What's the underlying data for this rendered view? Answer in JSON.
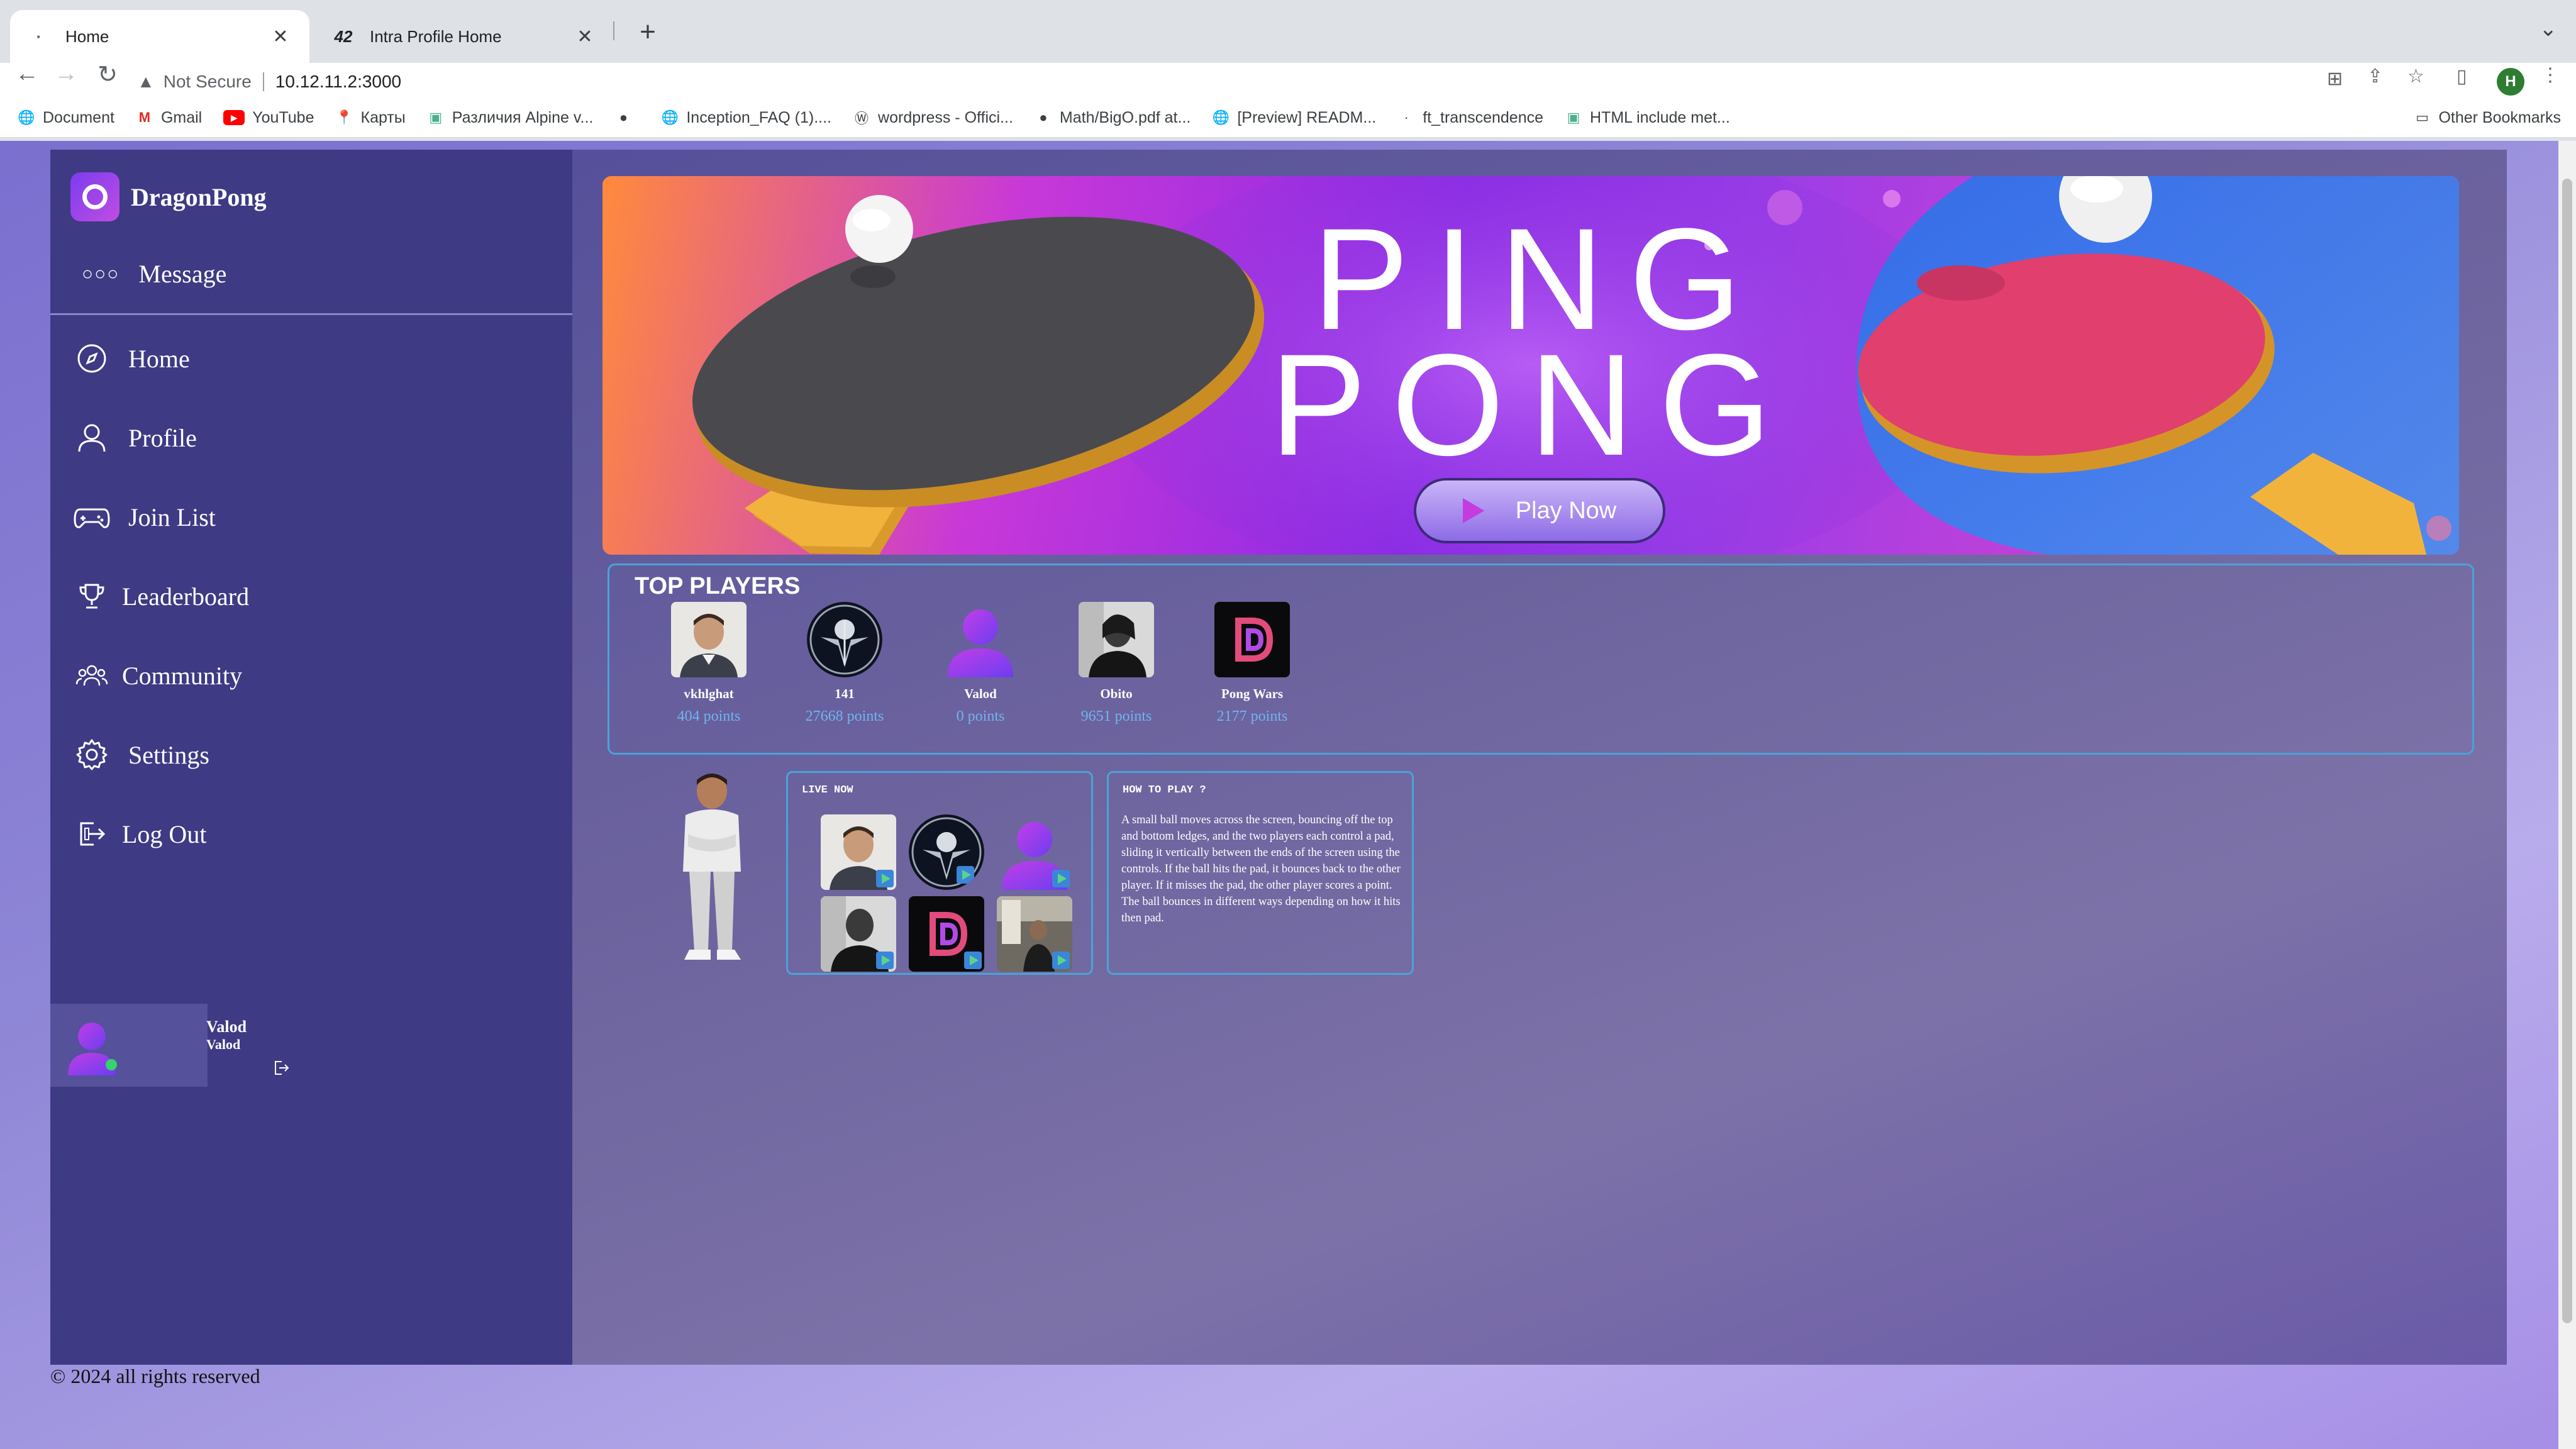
{
  "browser": {
    "tabs": [
      {
        "title": "Home",
        "favicon": "dot-icon"
      },
      {
        "title": "Intra Profile Home",
        "favicon": "42-logo-icon",
        "favicon_text": "42"
      }
    ],
    "address": {
      "security_label": "Not Secure",
      "url": "10.12.11.2:3000"
    },
    "profile_initial": "H",
    "bookmarks": [
      {
        "label": "Document",
        "icon": "globe-icon"
      },
      {
        "label": "Gmail",
        "icon": "gmail-icon"
      },
      {
        "label": "YouTube",
        "icon": "youtube-icon"
      },
      {
        "label": "Карты",
        "icon": "maps-icon"
      },
      {
        "label": "Различия Alpine v...",
        "icon": "page-icon"
      },
      {
        "label": "",
        "icon": "github-icon"
      },
      {
        "label": "Inception_FAQ (1)....",
        "icon": "globe-icon"
      },
      {
        "label": "wordpress - Offici...",
        "icon": "wordpress-icon"
      },
      {
        "label": "Math/BigO.pdf at...",
        "icon": "github-icon"
      },
      {
        "label": "[Preview] READM...",
        "icon": "globe-icon"
      },
      {
        "label": "ft_transcendence",
        "icon": "dot-icon"
      },
      {
        "label": "HTML include met...",
        "icon": "page-icon"
      }
    ],
    "other_bookmarks": "Other Bookmarks"
  },
  "app": {
    "brand": "DragonPong",
    "message_label": "Message",
    "nav": [
      {
        "label": "Home",
        "icon": "compass-icon"
      },
      {
        "label": "Profile",
        "icon": "user-icon"
      },
      {
        "label": "Join List",
        "icon": "gamepad-icon"
      },
      {
        "label": "Leaderboard",
        "icon": "trophy-icon"
      },
      {
        "label": "Community",
        "icon": "community-icon"
      },
      {
        "label": "Settings",
        "icon": "gear-icon"
      },
      {
        "label": "Log Out",
        "icon": "logout-icon"
      }
    ],
    "user": {
      "name": "Valod",
      "login": "Valod",
      "status": "online"
    },
    "footer": "© 2024 all rights reserved"
  },
  "banner": {
    "title_line1": "PING",
    "title_line2": "PONG",
    "cta": "Play Now"
  },
  "top_players": {
    "title": "TOP PLAYERS",
    "players": [
      {
        "name": "vkhlghat",
        "points": "404 points",
        "avatar": "photo-man-icon"
      },
      {
        "name": "141",
        "points": "27668 points",
        "avatar": "emblem-icon"
      },
      {
        "name": "Valod",
        "points": "0 points",
        "avatar": "default-user-icon"
      },
      {
        "name": "Obito",
        "points": "9651 points",
        "avatar": "photo-bw-icon"
      },
      {
        "name": "Pong Wars",
        "points": "2177 points",
        "avatar": "dp-logo-icon"
      }
    ]
  },
  "live_now": {
    "title": "LIVE NOW",
    "streams": [
      "photo-man-icon",
      "emblem-icon",
      "default-user-icon",
      "photo-bw-icon",
      "dp-logo-icon",
      "photo-gym-icon"
    ]
  },
  "how_to_play": {
    "title": "HOW TO PLAY ?",
    "text": "A small ball moves across the screen, bouncing off the top and bottom ledges, and the two players each control a pad, sliding it vertically between the ends of the screen using the controls. If the ball hits the pad, it bounces back to the other player. If it misses the pad, the other player scores a point. The ball bounces in different ways depending on how it hits then pad."
  },
  "colors": {
    "sidebar": "#3e3a84",
    "accent": "#4aa3d8",
    "points": "#6fb4f0"
  }
}
